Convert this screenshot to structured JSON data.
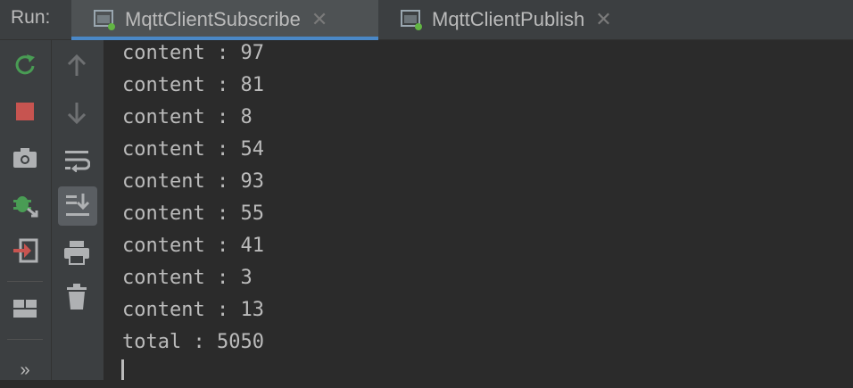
{
  "header": {
    "run_label": "Run:",
    "tabs": [
      {
        "label": "MqttClientSubscribe",
        "active": true,
        "icon": "run-config-icon"
      },
      {
        "label": "MqttClientPublish",
        "active": false,
        "icon": "run-config-icon"
      }
    ],
    "close_glyph": "✕"
  },
  "toolbar_left": [
    {
      "name": "rerun-icon",
      "color": "#499c54"
    },
    {
      "name": "stop-icon",
      "color": "#c75450"
    },
    {
      "name": "camera-icon",
      "color": "#afb1b3"
    },
    {
      "name": "debug-attach-icon",
      "color": "#499c54"
    },
    {
      "name": "exit-icon",
      "color": "#c75450"
    },
    {
      "name": "layout-icon",
      "color": "#afb1b3"
    },
    {
      "name": "more-icon",
      "label": "»"
    }
  ],
  "toolbar_right": [
    {
      "name": "arrow-up-icon"
    },
    {
      "name": "arrow-down-icon"
    },
    {
      "name": "soft-wrap-icon"
    },
    {
      "name": "scroll-to-end-icon",
      "selected": true
    },
    {
      "name": "print-icon"
    },
    {
      "name": "trash-icon"
    }
  ],
  "console": {
    "lines": [
      "content : 97",
      "content : 81",
      "content : 8",
      "content : 54",
      "content : 93",
      "content : 55",
      "content : 41",
      "content : 3",
      "content : 13",
      "total : 5050"
    ]
  },
  "colors": {
    "background": "#2b2b2b",
    "panel": "#3c3f41",
    "text": "#bbbbbb",
    "accent": "#4a88c7"
  }
}
